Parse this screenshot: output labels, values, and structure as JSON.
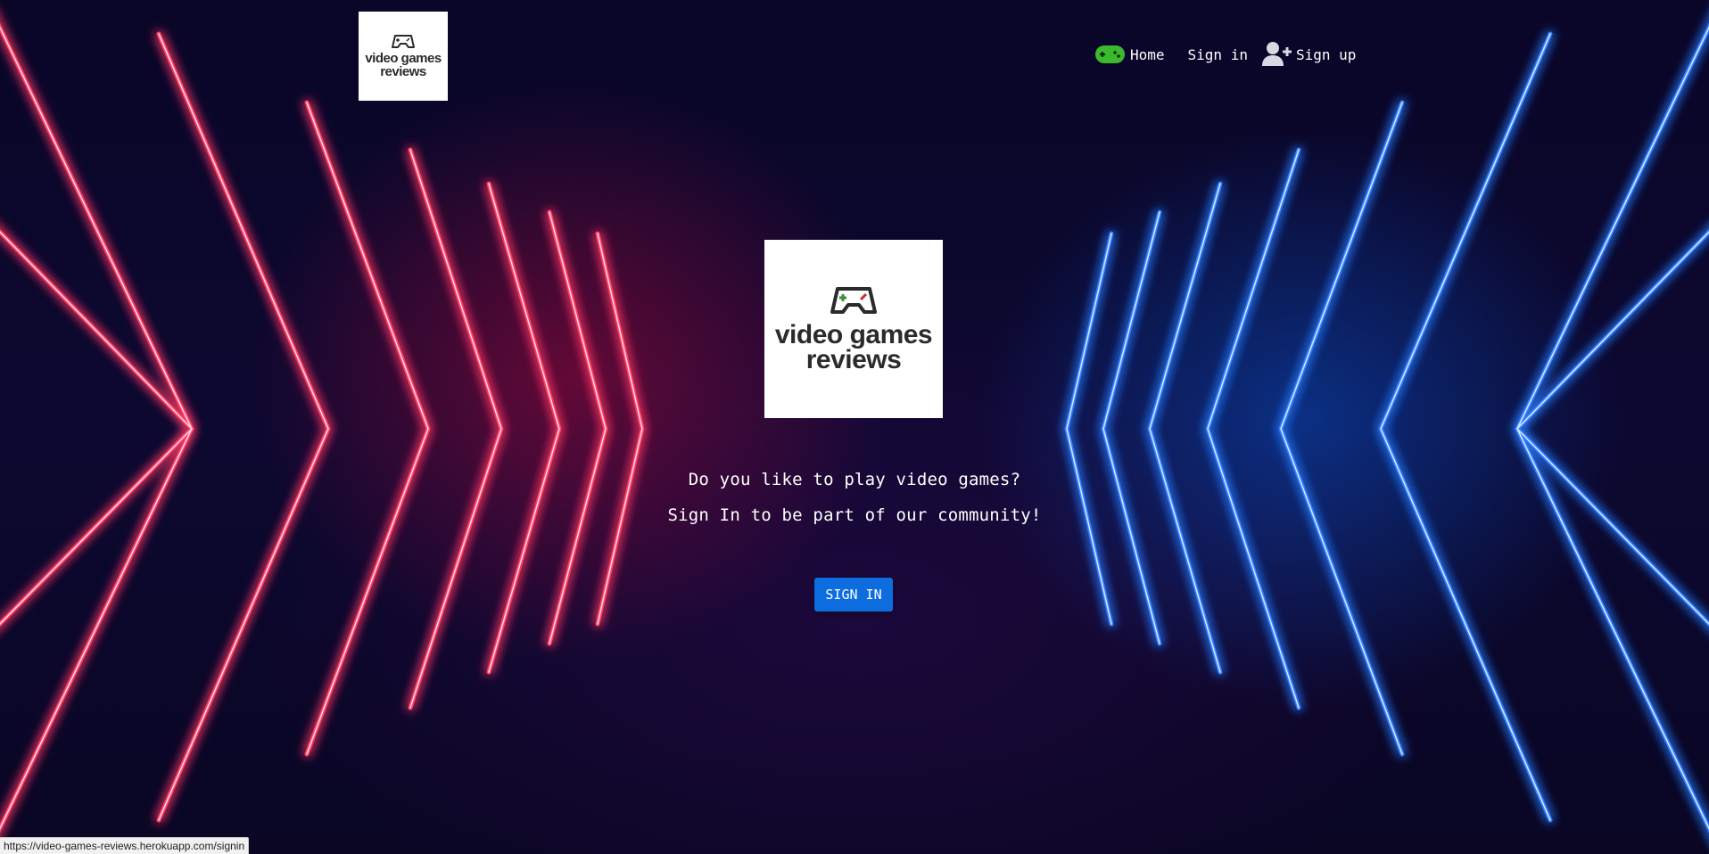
{
  "nav": {
    "logo": {
      "line1": "video games",
      "line2": "reviews",
      "icon": "gamepad-icon"
    },
    "home_label": "Home",
    "home_icon": "gamepad-icon",
    "signin_label": "Sign in",
    "signup_label": "Sign up",
    "signup_icon": "user-plus-icon"
  },
  "hero": {
    "logo": {
      "line1": "video games",
      "line2": "reviews",
      "icon": "gamepad-icon"
    },
    "line1": "Do you like to play video games?",
    "line2": "Sign In to be part of our community!",
    "button_label": "SIGN IN"
  },
  "status_bar": {
    "url": "https://video-games-reviews.herokuapp.com/signin"
  },
  "colors": {
    "background": "#0a0626",
    "neon_red": "#ff2d5a",
    "neon_blue": "#2a7bff",
    "button": "#0d6ddf",
    "home_icon": "#3cba2e"
  }
}
